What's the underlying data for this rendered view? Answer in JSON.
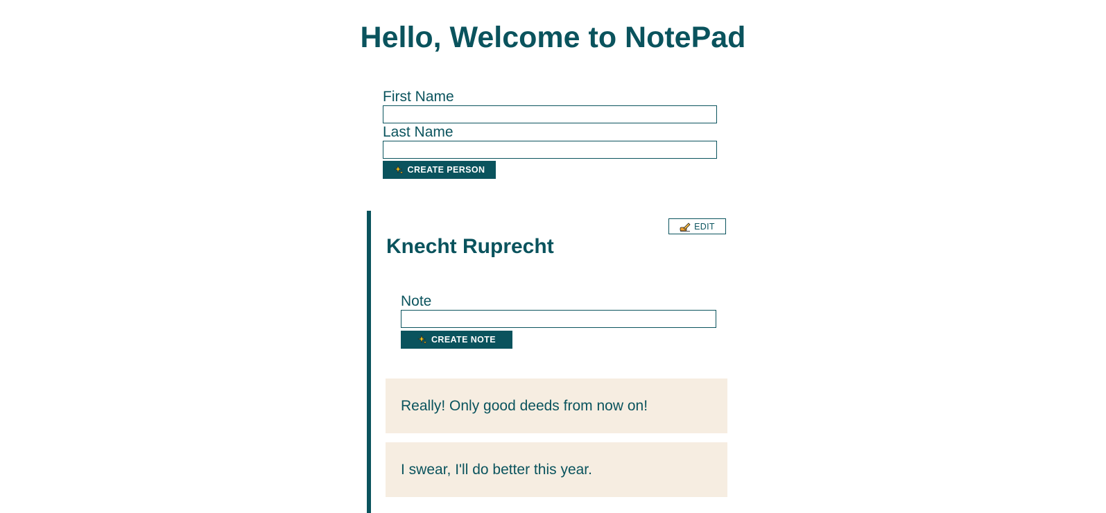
{
  "header": {
    "title": "Hello, Welcome to NotePad"
  },
  "person_form": {
    "first_name_label": "First Name",
    "first_name_value": "",
    "last_name_label": "Last Name",
    "last_name_value": "",
    "create_person_label": "CREATE PERSON",
    "button_icon": "sparkles-icon"
  },
  "person": {
    "name": "Knecht Ruprecht",
    "edit_label": "EDIT",
    "edit_icon": "writing-hand-icon",
    "note_form": {
      "note_label": "Note",
      "note_value": "",
      "create_note_label": "CREATE NOTE",
      "button_icon": "sparkles-icon"
    },
    "notes": [
      {
        "text": "Really! Only good deeds from now on!"
      },
      {
        "text": "I swear, I'll do better this year."
      }
    ]
  },
  "colors": {
    "primary": "#0a535d",
    "note_background": "#f6ede1",
    "background": "#ffffff"
  }
}
